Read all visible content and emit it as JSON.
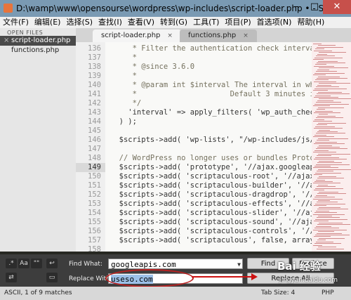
{
  "window": {
    "title": "D:\\wamp\\www\\opensourse\\wordpress\\wp-includes\\script-loader.php • - Subl..."
  },
  "menu": [
    "文件(F)",
    "编辑(E)",
    "选择(S)",
    "查找(I)",
    "查看(V)",
    "转到(G)",
    "工具(T)",
    "项目(P)",
    "首选项(N)",
    "帮助(H)"
  ],
  "sidebar": {
    "header": "OPEN FILES",
    "files": [
      "script-loader.php",
      "functions.php"
    ]
  },
  "tabs": [
    "script-loader.php",
    "functions.php"
  ],
  "code_lines": [
    {
      "n": "136",
      "t": "     * Filter the authentication check interval"
    },
    {
      "n": "137",
      "t": "     *"
    },
    {
      "n": "138",
      "t": "     * @since 3.6.0"
    },
    {
      "n": "139",
      "t": "     *"
    },
    {
      "n": "140",
      "t": "     * @param int $interval The interval in whi"
    },
    {
      "n": "141",
      "t": "     *                     Default 3 minutes i"
    },
    {
      "n": "142",
      "t": "     */"
    },
    {
      "n": "143",
      "t": "    'interval' => apply_filters( 'wp_auth_check"
    },
    {
      "n": "144",
      "t": "  ) );"
    },
    {
      "n": "145",
      "t": ""
    },
    {
      "n": "146",
      "t": "  $scripts->add( 'wp-lists', \"/wp-includes/js/wp"
    },
    {
      "n": "147",
      "t": ""
    },
    {
      "n": "148",
      "t": "  // WordPress no longer uses or bundles Prototyp"
    },
    {
      "n": "149",
      "t": "  $scripts->add( 'prototype', '//ajax.googleapis."
    },
    {
      "n": "150",
      "t": "  $scripts->add( 'scriptaculous-root', '//ajax.go"
    },
    {
      "n": "151",
      "t": "  $scripts->add( 'scriptaculous-builder', '//ajax"
    },
    {
      "n": "152",
      "t": "  $scripts->add( 'scriptaculous-dragdrop', '//aja"
    },
    {
      "n": "153",
      "t": "  $scripts->add( 'scriptaculous-effects', '//ajax"
    },
    {
      "n": "154",
      "t": "  $scripts->add( 'scriptaculous-slider', '//ajax."
    },
    {
      "n": "155",
      "t": "  $scripts->add( 'scriptaculous-sound', '//ajax.g"
    },
    {
      "n": "156",
      "t": "  $scripts->add( 'scriptaculous-controls', '//aja"
    },
    {
      "n": "157",
      "t": "  $scripts->add( 'scriptaculous', false, array('s"
    },
    {
      "n": "158",
      "t": ""
    }
  ],
  "current_line": "149",
  "find": {
    "option_buttons": [
      ".*",
      "Aa",
      "\"\"",
      "↩",
      "▭",
      "⇄"
    ],
    "find_label": "Find What:",
    "find_value": "googleapis.com",
    "replace_label": "Replace With:",
    "replace_value": "useso.com",
    "find_button": "Find",
    "replace_button": "Replace",
    "replace_all_button": "Replace All"
  },
  "status": {
    "left": "ASCII, 1 of 9 matches",
    "tab_size": "Tab Size: 4",
    "syntax": "PHP"
  },
  "watermark": {
    "logo": "Bai 经验",
    "url": "jingyan.baidu.com"
  }
}
